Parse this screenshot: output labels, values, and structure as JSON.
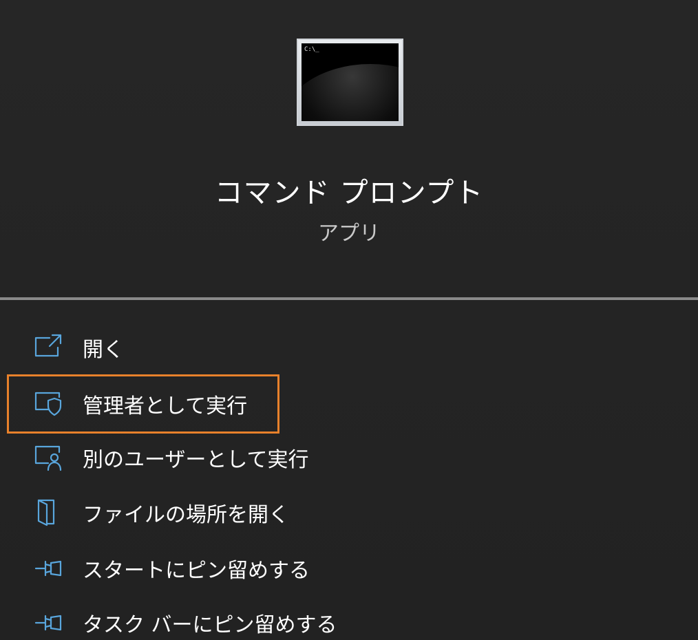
{
  "app": {
    "name": "コマンド プロンプト",
    "type": "アプリ",
    "icon_prompt_text": "C:\\_"
  },
  "menu": {
    "items": [
      {
        "label": "開く",
        "icon": "open-external-icon"
      },
      {
        "label": "管理者として実行",
        "icon": "admin-shield-icon",
        "focused": true
      },
      {
        "label": "別のユーザーとして実行",
        "icon": "user-monitor-icon"
      },
      {
        "label": "ファイルの場所を開く",
        "icon": "folder-door-icon"
      },
      {
        "label": "スタートにピン留めする",
        "icon": "pin-icon"
      },
      {
        "label": "タスク バーにピン留めする",
        "icon": "pin-icon"
      }
    ]
  },
  "colors": {
    "background": "#232323",
    "accent_icon": "#59a6dd",
    "focus_ring": "#e8812b",
    "divider": "#8a8a8a"
  }
}
